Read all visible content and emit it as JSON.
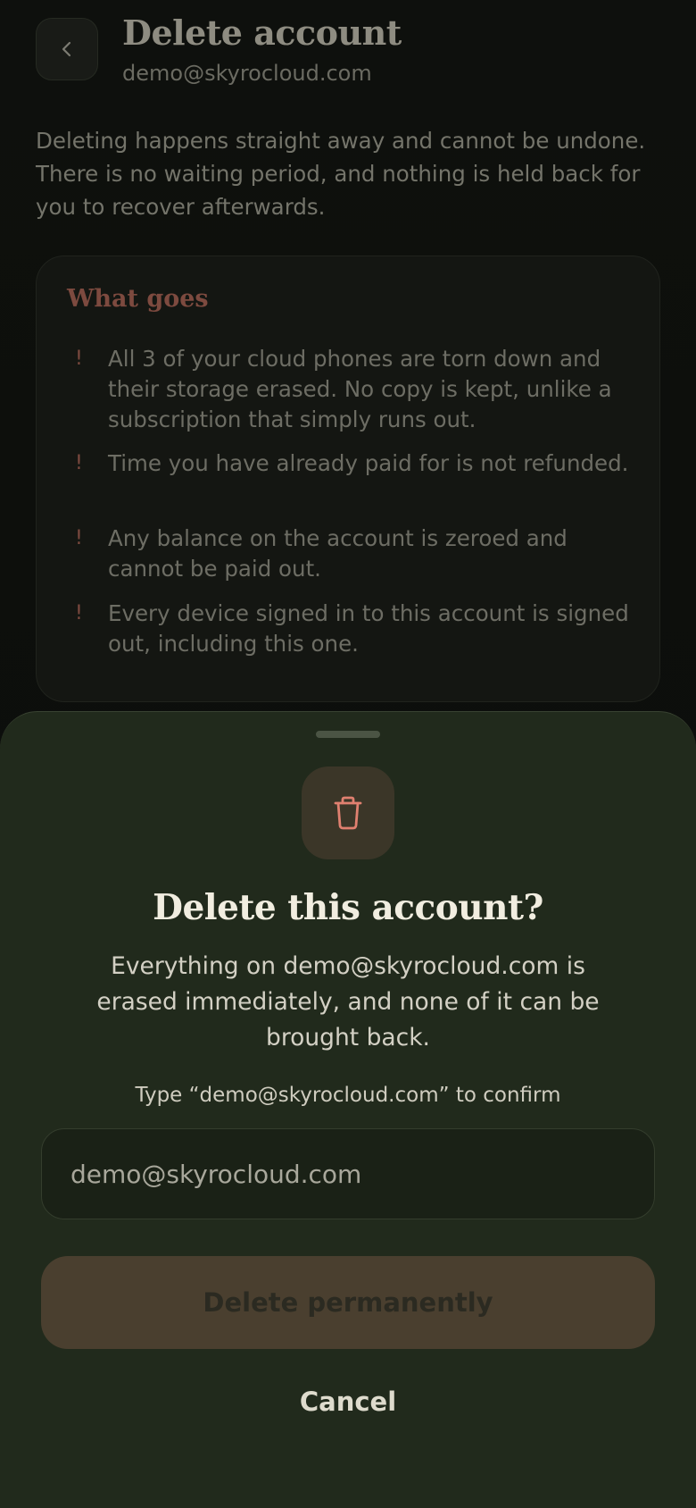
{
  "header": {
    "title": "Delete account",
    "subtitle": "demo@skyrocloud.com",
    "back_icon": "chevron-left-icon"
  },
  "intro": "Deleting happens straight away and cannot be undone. There is no waiting period, and nothing is held back for you to recover afterwards.",
  "what_goes": {
    "title": "What goes",
    "marker": "!",
    "items": [
      "All 3 of your cloud phones are torn down and their storage erased. No copy is kept, unlike a subscription that simply runs out.",
      "Time you have already paid for is not refunded.",
      "Any balance on the account is zeroed and cannot be paid out.",
      "Every device signed in to this account is signed out, including this one."
    ]
  },
  "sheet": {
    "icon": "trash-icon",
    "title": "Delete this account?",
    "body": "Everything on demo@skyrocloud.com is erased immediately, and none of it can be brought back.",
    "confirm_label": "Type “demo@skyrocloud.com” to confirm",
    "confirm_value": "demo@skyrocloud.com",
    "delete_label": "Delete permanently",
    "cancel_label": "Cancel"
  },
  "colors": {
    "background": "#0d0f0b",
    "sheet": "#212a1c",
    "danger": "#e08070",
    "danger_muted": "#7d4a3f",
    "delete_button": "#4a3f2f"
  }
}
